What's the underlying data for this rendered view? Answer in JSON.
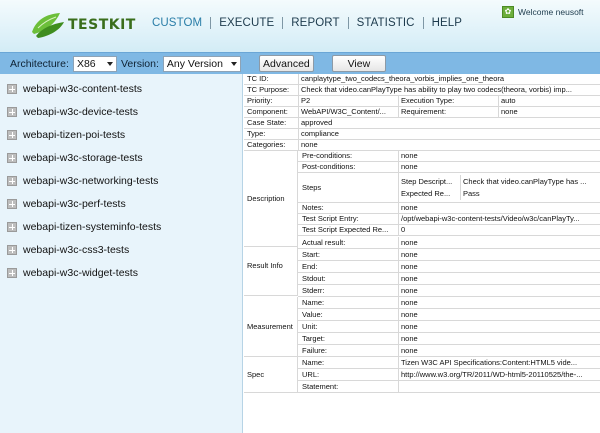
{
  "header": {
    "logo_text": "TESTKIT",
    "nav": [
      "CUSTOM",
      "EXECUTE",
      "REPORT",
      "STATISTIC",
      "HELP"
    ],
    "active_nav": "CUSTOM",
    "welcome": "Welcome neusoft",
    "colors": {
      "accent": "#2a7ea8",
      "logo_green": "#3a6e1c",
      "toolbar": "#7fb8e4",
      "sidebar": "#e8f4fb"
    }
  },
  "toolbar": {
    "architecture_label": "Architecture:",
    "architecture_value": "X86",
    "version_label": "Version:",
    "version_value": "Any Version",
    "advanced_label": "Advanced",
    "view_label": "View"
  },
  "sidebar": {
    "items": [
      "webapi-w3c-content-tests",
      "webapi-w3c-device-tests",
      "webapi-tizen-poi-tests",
      "webapi-w3c-storage-tests",
      "webapi-w3c-networking-tests",
      "webapi-w3c-perf-tests",
      "webapi-tizen-systeminfo-tests",
      "webapi-w3c-css3-tests",
      "webapi-w3c-widget-tests"
    ]
  },
  "detail": {
    "tc_id_label": "TC ID:",
    "tc_id": "canplaytype_two_codecs_theora_vorbis_implies_one_theora",
    "tc_purpose_label": "TC Purpose:",
    "tc_purpose": "Check that video.canPlayType has ability to play two codecs(theora, vorbis) imp...",
    "priority_label": "Priority:",
    "priority": "P2",
    "execution_type_label": "Execution Type:",
    "execution_type": "auto",
    "component_label": "Component:",
    "component": "WebAPI/W3C_Content/...",
    "requirement_label": "Requirement:",
    "requirement": "none",
    "case_state_label": "Case State:",
    "case_state": "approved",
    "type_label": "Type:",
    "type": "compliance",
    "categories_label": "Categories:",
    "categories": "none",
    "description_label": "Description",
    "preconditions_label": "Pre-conditions:",
    "preconditions": "none",
    "postconditions_label": "Post-conditions:",
    "postconditions": "none",
    "steps_label": "Steps",
    "step_description_label": "Step Descript...",
    "step_description": "Check that video.canPlayType has ...",
    "expected_result_label": "Expected Re...",
    "expected_result": "Pass",
    "notes_label": "Notes:",
    "notes": "none",
    "test_script_entry_label": "Test Script Entry:",
    "test_script_entry": "/opt/webapi-w3c-content-tests/Video/w3c/canPlayTy...",
    "test_script_expected_label": "Test Script Expected Re...",
    "test_script_expected": "0",
    "result_info_label": "Result Info",
    "actual_result_label": "Actual result:",
    "actual_result": "none",
    "start_label": "Start:",
    "start": "none",
    "end_label": "End:",
    "end": "none",
    "stdout_label": "Stdout:",
    "stdout": "none",
    "stderr_label": "Stderr:",
    "stderr": "none",
    "measurement_label": "Measurement",
    "m_name_label": "Name:",
    "m_name": "none",
    "m_value_label": "Value:",
    "m_value": "none",
    "m_unit_label": "Unit:",
    "m_unit": "none",
    "m_target_label": "Target:",
    "m_target": "none",
    "m_failure_label": "Failure:",
    "m_failure": "none",
    "spec_label": "Spec",
    "spec_name_label": "Name:",
    "spec_name": "Tizen W3C API Specifications:Content:HTML5 vide...",
    "spec_url_label": "URL:",
    "spec_url": "http://www.w3.org/TR/2011/WD-html5-20110525/the-...",
    "spec_statement_label": "Statement:",
    "spec_statement": ""
  }
}
